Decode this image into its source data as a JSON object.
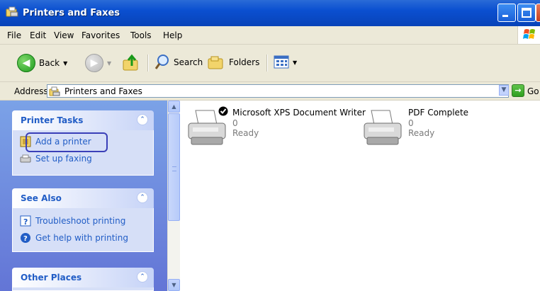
{
  "window": {
    "title": "Printers and Faxes",
    "title_icon": "printers-folder-icon"
  },
  "menu": [
    {
      "label": "File"
    },
    {
      "label": "Edit"
    },
    {
      "label": "View"
    },
    {
      "label": "Favorites"
    },
    {
      "label": "Tools"
    },
    {
      "label": "Help"
    }
  ],
  "toolbar": {
    "back_label": "Back",
    "search_label": "Search",
    "folders_label": "Folders"
  },
  "address": {
    "label": "Address",
    "value": "Printers and Faxes",
    "go_label": "Go"
  },
  "taskpane": {
    "printer_tasks": {
      "title": "Printer Tasks",
      "links": [
        {
          "label": "Add a printer",
          "icon": "add-printer-icon"
        },
        {
          "label": "Set up faxing",
          "icon": "fax-icon"
        }
      ]
    },
    "see_also": {
      "title": "See Also",
      "links": [
        {
          "label": "Troubleshoot printing",
          "icon": "help-book-icon"
        },
        {
          "label": "Get help with printing",
          "icon": "help-circle-icon"
        }
      ]
    },
    "other_places": {
      "title": "Other Places"
    }
  },
  "printers": [
    {
      "name": "Microsoft XPS Document Writer",
      "count": "0",
      "status": "Ready",
      "default": true
    },
    {
      "name": "PDF Complete",
      "count": "0",
      "status": "Ready",
      "default": false
    }
  ],
  "colors": {
    "titlebar": "#0a4fd0",
    "taskpane_bg": "#6d8fe0",
    "link": "#215dc6",
    "highlight_border": "#3a3fb8"
  }
}
